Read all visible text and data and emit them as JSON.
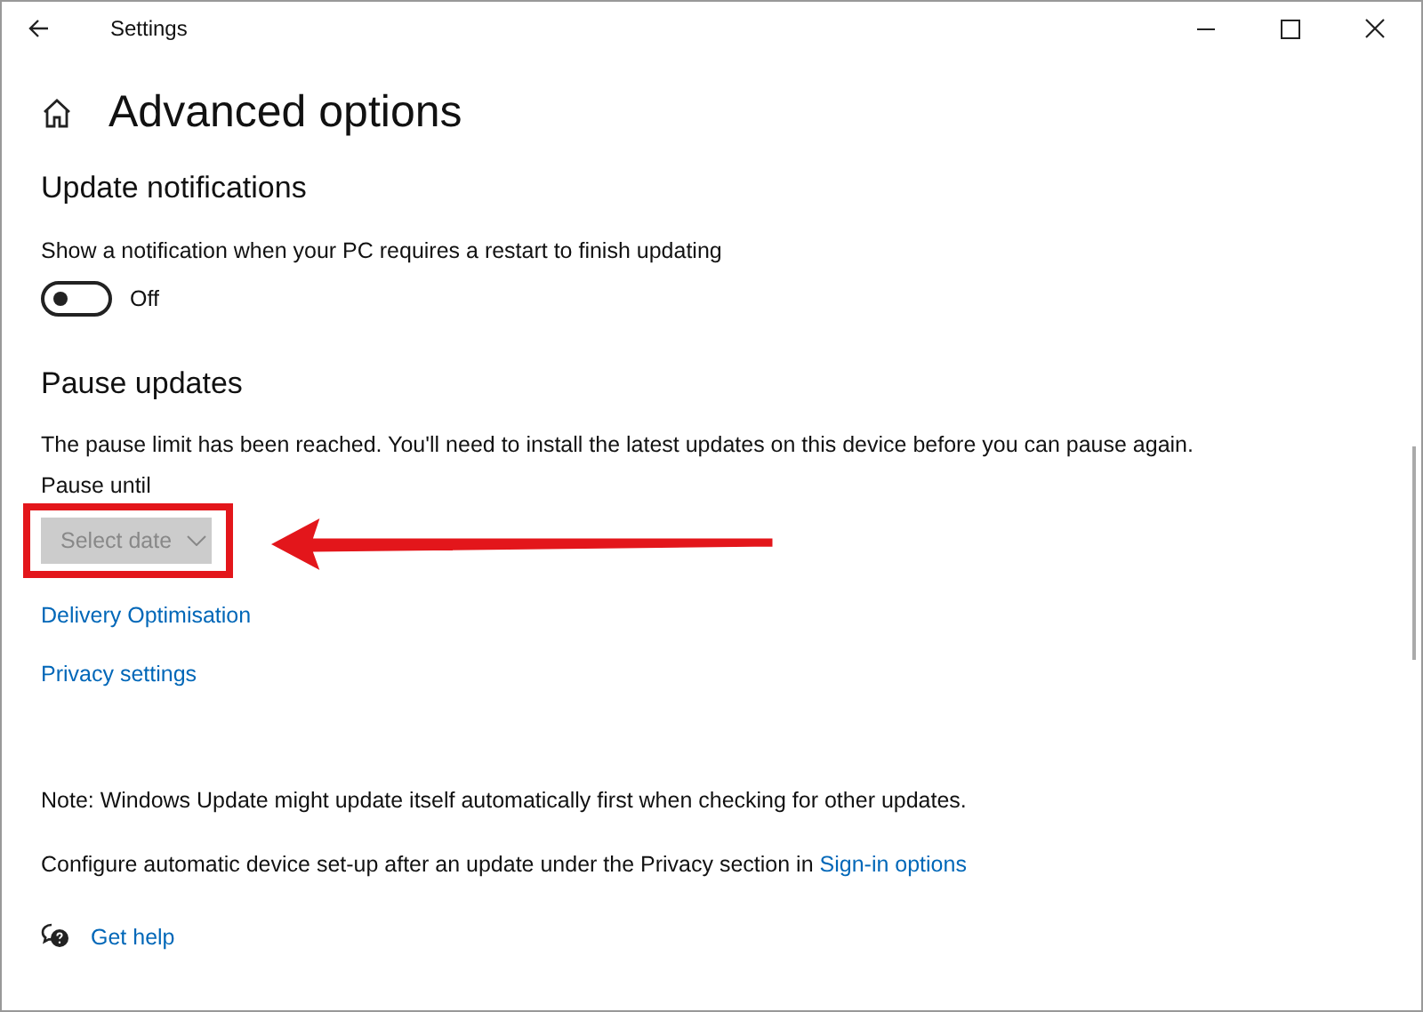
{
  "window": {
    "title": "Settings"
  },
  "page": {
    "title": "Advanced options"
  },
  "notifications": {
    "heading": "Update notifications",
    "description": "Show a notification when your PC requires a restart to finish updating",
    "toggle": {
      "on": false,
      "label": "Off"
    }
  },
  "pause": {
    "heading": "Pause updates",
    "message": "The pause limit has been reached. You'll need to install the latest updates on this device before you can pause again.",
    "label": "Pause until",
    "dropdown": {
      "placeholder": "Select date",
      "disabled": true
    }
  },
  "links": [
    {
      "label": "Delivery Optimisation"
    },
    {
      "label": "Privacy settings"
    }
  ],
  "note": "Note: Windows Update might update itself automatically first when checking for other updates.",
  "configure": {
    "text": "Configure automatic device set-up after an update under the Privacy section in",
    "link": "Sign-in options"
  },
  "help": {
    "label": "Get help"
  }
}
